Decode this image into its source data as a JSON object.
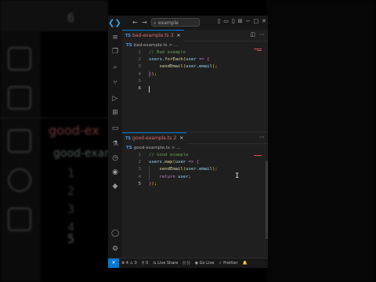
{
  "background": {
    "line_number": "6",
    "tab_label": "good-ex",
    "file_label": "good-example.ts",
    "line_numbers": [
      "1",
      "2",
      "3",
      "4",
      "5"
    ]
  },
  "titlebar": {
    "search_placeholder": "example"
  },
  "editor_top": {
    "tab": {
      "label": "bad-example.ts",
      "badge": "3"
    },
    "breadcrumb": {
      "file": "bad-example.ts",
      "rest": "> ..."
    },
    "lines": [
      {
        "n": "1",
        "comment": "// Bad example"
      },
      {
        "n": "2",
        "obj": "users",
        "dot": ".",
        "fn": "forEach",
        "p1": "(",
        "arg": "user",
        "arrow": " => ",
        "p2": "{"
      },
      {
        "n": "3",
        "fn": "sendEmail",
        "p1": "(",
        "obj": "user",
        "dot": ".",
        "prop": "email",
        "p2": ");"
      },
      {
        "n": "4",
        "p1": "}",
        "p2": ");"
      },
      {
        "n": "5"
      },
      {
        "n": "6"
      }
    ]
  },
  "editor_bottom": {
    "tab": {
      "label": "good-example.ts",
      "badge": "2"
    },
    "breadcrumb": {
      "file": "good-example.ts",
      "rest": "> ..."
    },
    "lines": [
      {
        "n": "1",
        "comment": "// Good example"
      },
      {
        "n": "2",
        "obj": "users",
        "dot": ".",
        "fn": "map",
        "p1": "(",
        "arg": "user",
        "arrow": " => ",
        "p2": "{"
      },
      {
        "n": "3",
        "fn": "sendEmail",
        "p1": "(",
        "obj": "user",
        "dot": ".",
        "prop": "email",
        "p2": ");"
      },
      {
        "n": "4",
        "kw": "return",
        "val": " user",
        "semi": ";"
      },
      {
        "n": "5",
        "p1": "}",
        "p2": ");"
      }
    ]
  },
  "statusbar": {
    "errors": "4",
    "warnings": "0",
    "ports": "0",
    "live_share": "Live Share",
    "go_live": "Go Live",
    "prettier": "Prettier"
  },
  "colors": {
    "accent": "#0078d4",
    "error_tab": "#e06c6c",
    "comment": "#6a9955",
    "function": "#dcdcaa",
    "variable": "#9cdcfe",
    "keyword": "#c586c0"
  }
}
